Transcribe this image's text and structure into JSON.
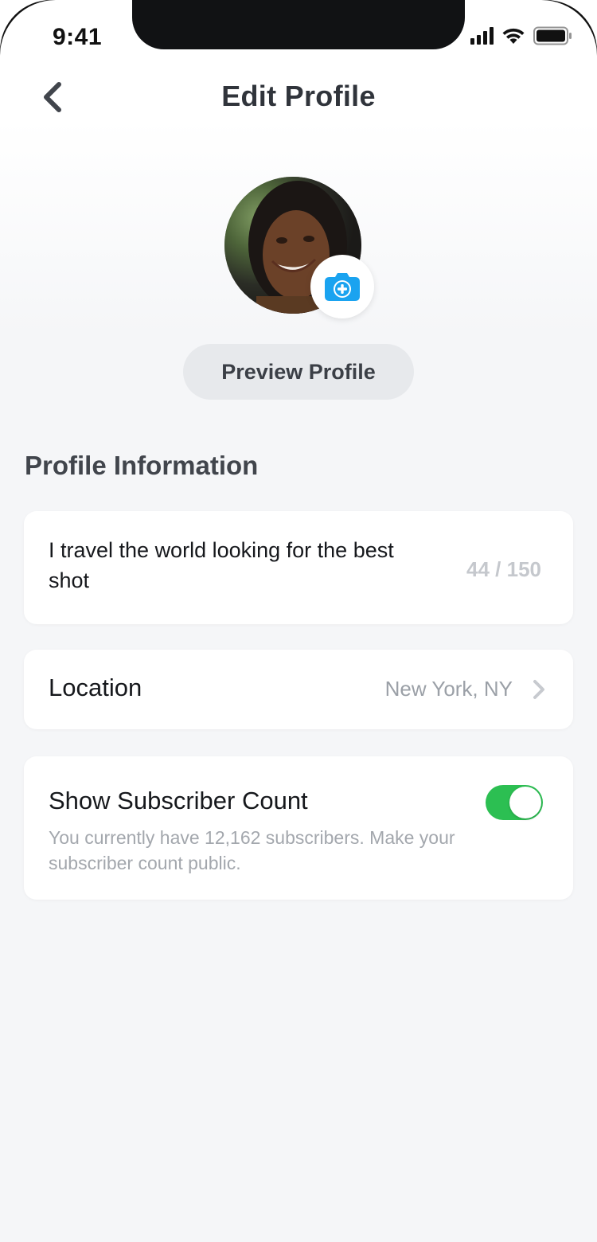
{
  "status_bar": {
    "time": "9:41"
  },
  "header": {
    "title": "Edit Profile",
    "back_icon": "chevron-left-icon"
  },
  "profile": {
    "avatar_alt": "profile photo",
    "camera_icon": "camera-add-icon",
    "preview_button_label": "Preview Profile"
  },
  "section": {
    "title": "Profile Information"
  },
  "bio": {
    "text": "I travel the world looking for the best shot",
    "counter": "44 / 150"
  },
  "location": {
    "label": "Location",
    "value": "New York, NY"
  },
  "subscriber": {
    "label": "Show Subscriber Count",
    "description": "You currently have 12,162 subscribers. Make your subscriber count public.",
    "enabled": true
  },
  "colors": {
    "accent_blue": "#1aa3f0",
    "toggle_green": "#2cbf52",
    "title_text": "#30343b",
    "muted_text": "#a3a7ad"
  }
}
